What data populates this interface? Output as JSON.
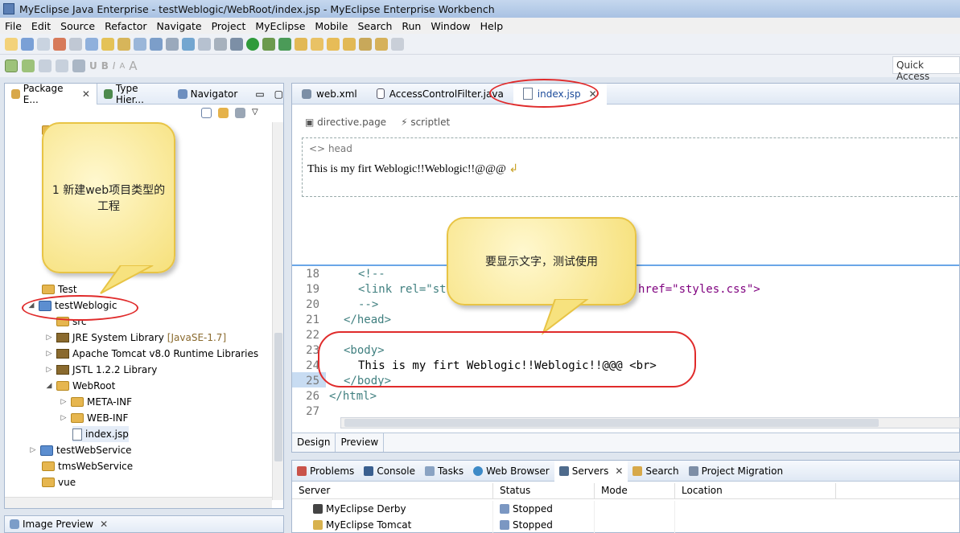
{
  "window": {
    "title": "MyEclipse Java Enterprise - testWeblogic/WebRoot/index.jsp - MyEclipse Enterprise Workbench"
  },
  "menu": [
    "File",
    "Edit",
    "Source",
    "Refactor",
    "Navigate",
    "Project",
    "MyEclipse",
    "Mobile",
    "Search",
    "Run",
    "Window",
    "Help"
  ],
  "quick_access": "Quick Access",
  "left_tabs": {
    "package": "Package E...",
    "hierarchy": "Type Hier...",
    "navigator": "Navigator"
  },
  "tree": {
    "test": "Test",
    "testWeblogic": "testWeblogic",
    "src": "src",
    "jre": "JRE System Library",
    "jre_tag": "[JavaSE-1.7]",
    "tomcat": "Apache Tomcat v8.0 Runtime Libraries",
    "jstl": "JSTL 1.2.2 Library",
    "webroot": "WebRoot",
    "metainf": "META-INF",
    "webinf": "WEB-INF",
    "index": "index.jsp",
    "testWebService": "testWebService",
    "tmsWebService": "tmsWebService",
    "vue": "vue"
  },
  "image_preview": "Image Preview",
  "editor_tabs": {
    "webxml": "web.xml",
    "filter": "AccessControlFilter.java",
    "index": "index.jsp"
  },
  "palette": {
    "directive": "directive.page",
    "scriptlet": "scriptlet"
  },
  "design": {
    "head_label": "head",
    "body_text": "This is my firt Weblogic!!Weblogic!!@@@"
  },
  "code_lines": [
    {
      "num": "18",
      "text": "<!--"
    },
    {
      "num": "19",
      "text": "<link rel=\"st"
    },
    {
      "num": "19b",
      "text": "href=\"styles.css\">"
    },
    {
      "num": "20",
      "text": "-->"
    },
    {
      "num": "21",
      "text": "</head>"
    },
    {
      "num": "22",
      "text": ""
    },
    {
      "num": "23",
      "text": "<body>"
    },
    {
      "num": "24",
      "text": "This is my firt Weblogic!!Weblogic!!@@@ <br>"
    },
    {
      "num": "25",
      "text": "</body>"
    },
    {
      "num": "26",
      "text": "</html>"
    },
    {
      "num": "27",
      "text": ""
    }
  ],
  "design_tabs": {
    "design": "Design",
    "preview": "Preview"
  },
  "bottom_tabs": [
    "Problems",
    "Console",
    "Tasks",
    "Web Browser",
    "Servers",
    "Search",
    "Project Migration"
  ],
  "servers_columns": [
    "Server",
    "Status",
    "Mode",
    "Location"
  ],
  "servers": [
    {
      "name": "MyEclipse Derby",
      "status": "Stopped"
    },
    {
      "name": "MyEclipse Tomcat",
      "status": "Stopped"
    }
  ],
  "callouts": {
    "left": "1 新建web项目类型的工程",
    "editor": "要显示文字，测试使用"
  }
}
